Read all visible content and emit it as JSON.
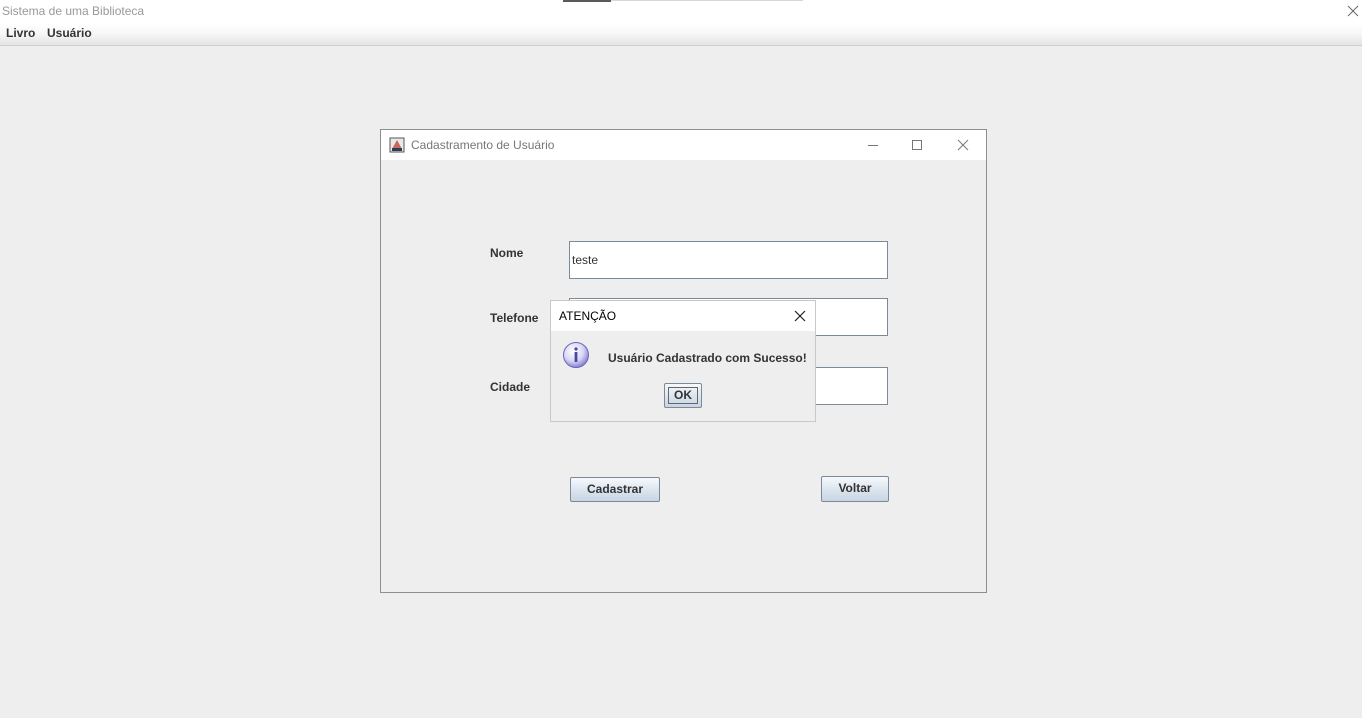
{
  "main_window": {
    "title": "Sistema de uma Biblioteca",
    "close_icon": "close-icon"
  },
  "menubar": {
    "items": [
      {
        "label": "Livro"
      },
      {
        "label": "Usuário"
      }
    ]
  },
  "internal_frame": {
    "title": "Cadastramento de Usuário",
    "icons": [
      "java-app-icon",
      "minimize-icon",
      "maximize-icon",
      "close-icon"
    ],
    "form": {
      "nome_label": "Nome",
      "nome_value": "teste",
      "telefone_label": "Telefone",
      "telefone_value": "",
      "cidade_label": "Cidade",
      "cidade_value": ""
    },
    "buttons": {
      "cadastrar": "Cadastrar",
      "voltar": "Voltar"
    }
  },
  "dialog": {
    "title": "ATENÇÃO",
    "message": "Usuário Cadastrado com Sucesso!",
    "ok_label": "OK",
    "icon": "info-icon"
  },
  "colors": {
    "background": "#eeeeee",
    "titlebar": "#ffffff",
    "button_gradient_top": "#f6f9fc",
    "button_gradient_bottom": "#c8d5e2",
    "field_border": "#7a8a99",
    "info_icon": "#8a86d6"
  }
}
